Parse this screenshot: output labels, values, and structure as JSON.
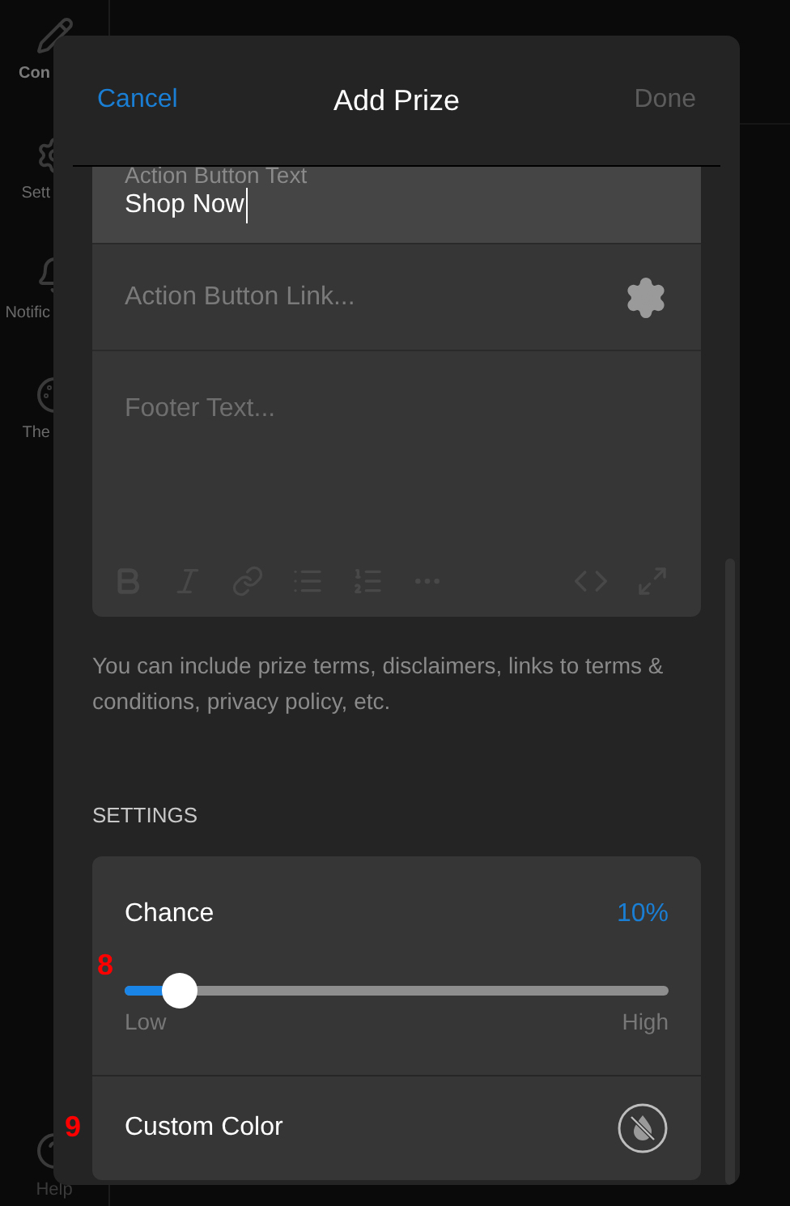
{
  "sidebar": {
    "items": [
      {
        "label": "Con",
        "selected": true
      },
      {
        "label": "Sett",
        "selected": false
      },
      {
        "label": "Notific",
        "selected": false
      },
      {
        "label": "The",
        "selected": false
      }
    ],
    "help": {
      "label": "Help"
    }
  },
  "dialog": {
    "title": "Add Prize",
    "cancel": "Cancel",
    "done": {
      "label": "Done",
      "disabled": true
    }
  },
  "fields": [
    {
      "kind": "text",
      "label": "Action Button Text",
      "value": "Shop Now",
      "focused": true
    },
    {
      "kind": "link",
      "placeholder": "Action Button Link..."
    },
    {
      "kind": "editor",
      "placeholder": "Footer Text..."
    }
  ],
  "help_text": "You can include prize terms, disclaimers, links to terms & conditions, privacy policy, etc.",
  "settings": {
    "heading": "SETTINGS",
    "rows": [
      {
        "kind": "slider",
        "marker": "8",
        "label": "Chance",
        "reading": "10%",
        "level": 0.1,
        "min_label": "Low",
        "max_label": "High"
      },
      {
        "kind": "color",
        "marker": "9",
        "label": "Custom Color",
        "on": false
      }
    ]
  }
}
